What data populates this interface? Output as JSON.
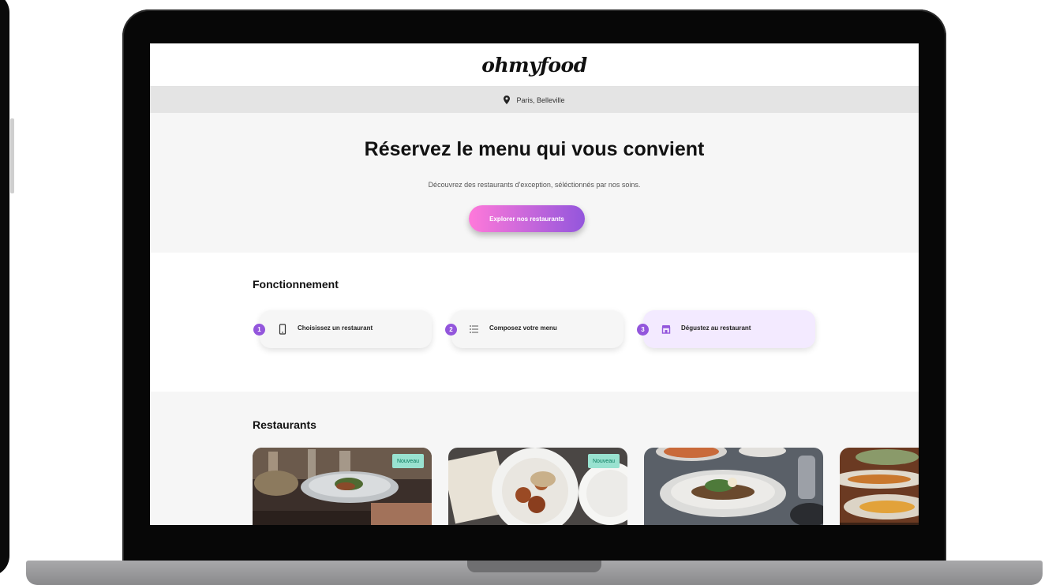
{
  "site": {
    "logo": "ohmyfood",
    "location": "Paris, Belleville"
  },
  "hero": {
    "title": "Réservez le menu qui vous convient",
    "subtitle": "Découvrez des restaurants d'exception, séléctionnés par nos soins.",
    "cta_label": "Explorer nos restaurants"
  },
  "how_it_works": {
    "title": "Fonctionnement",
    "steps": [
      {
        "number": "1",
        "icon": "mobile-phone-icon",
        "label": "Choisissez un restaurant"
      },
      {
        "number": "2",
        "icon": "list-icon",
        "label": "Composez votre menu"
      },
      {
        "number": "3",
        "icon": "store-icon",
        "label": "Dégustez au restaurant"
      }
    ]
  },
  "restaurants": {
    "title": "Restaurants",
    "cards": [
      {
        "badge": "Nouveau"
      },
      {
        "badge": "Nouveau"
      },
      {
        "badge": ""
      },
      {
        "badge": ""
      }
    ]
  },
  "colors": {
    "accent_purple": "#9356dc",
    "accent_pink": "#ff79da",
    "badge_green": "#99e2d0"
  }
}
